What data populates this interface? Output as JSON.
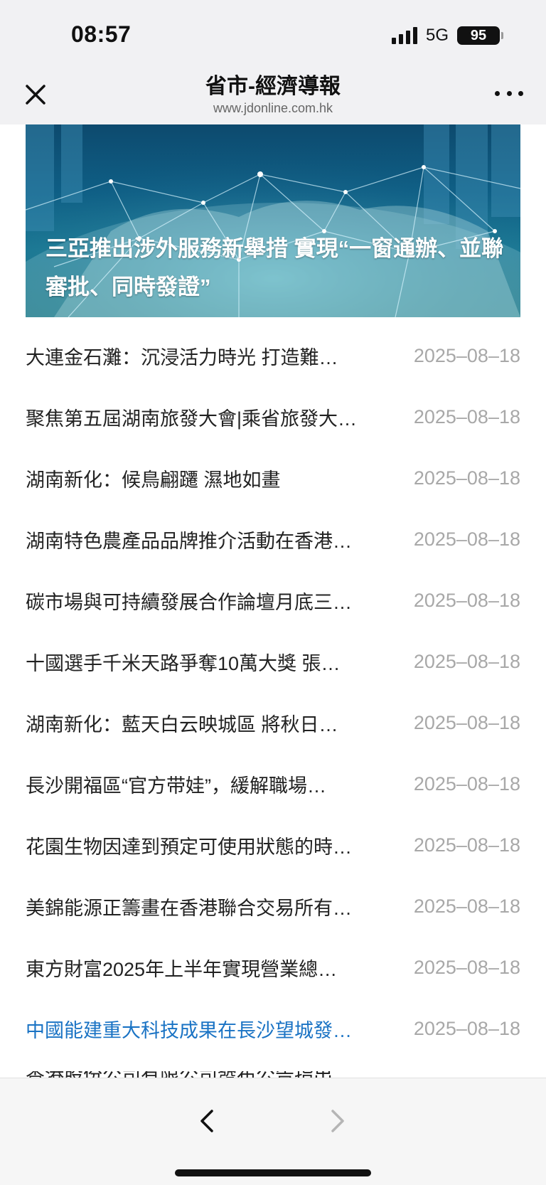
{
  "status_bar": {
    "time": "08:57",
    "network": "5G",
    "battery": "95"
  },
  "nav": {
    "title": "省市-經濟導報",
    "subtitle": "www.jdonline.com.hk",
    "close_icon": "close-icon",
    "more_icon": "more-icon"
  },
  "banner": {
    "caption": "三亞推出涉外服務新舉措 實現“一窗通辦、並聯審批、同時發證”"
  },
  "news": [
    {
      "title": "大連金石灘：沉浸活力時光 打造難…",
      "date": "2025–08–18",
      "active": false
    },
    {
      "title": "聚焦第五屆湖南旅發大會|乘省旅發大…",
      "date": "2025–08–18",
      "active": false
    },
    {
      "title": "湖南新化：候鳥翩躚 濕地如畫",
      "date": "2025–08–18",
      "active": false
    },
    {
      "title": "湖南特色農產品品牌推介活動在香港…",
      "date": "2025–08–18",
      "active": false
    },
    {
      "title": "碳市場與可持續發展合作論壇月底三…",
      "date": "2025–08–18",
      "active": false
    },
    {
      "title": "十國選手千米天路爭奪10萬大獎 張…",
      "date": "2025–08–18",
      "active": false
    },
    {
      "title": "湖南新化：藍天白云映城區 將秋日…",
      "date": "2025–08–18",
      "active": false
    },
    {
      "title": "長沙開福區“官方带娃”，緩解職場…",
      "date": "2025–08–18",
      "active": false
    },
    {
      "title": "花園生物因達到預定可使用狀態的時…",
      "date": "2025–08–18",
      "active": false
    },
    {
      "title": "美錦能源正籌畫在香港聯合交易所有…",
      "date": "2025–08–18",
      "active": false
    },
    {
      "title": "東方財富2025年上半年實現營業總…",
      "date": "2025–08–18",
      "active": false
    },
    {
      "title": "中國能建重大科技成果在長沙望城發…",
      "date": "2025–08–18",
      "active": true
    }
  ],
  "peek": {
    "title": "香港股份公司有限公司發布公告指出…"
  },
  "toolbar": {
    "back_icon": "chevron-left-icon",
    "forward_icon": "chevron-right-icon"
  },
  "colors": {
    "link_active": "#1a73c4",
    "date_gray": "#a8a8a8",
    "bar_bg": "#f1f1f3"
  }
}
